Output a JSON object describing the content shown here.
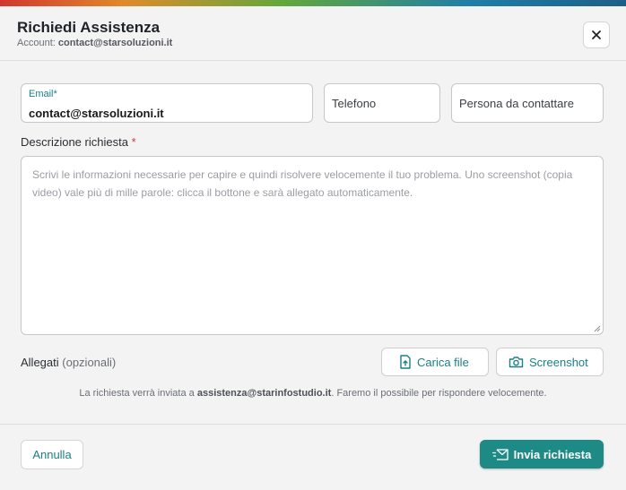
{
  "dialog": {
    "title": "Richiedi Assistenza",
    "account_label": "Account:",
    "account_value": "contact@starsoluzioni.it"
  },
  "form": {
    "email_label": "Email*",
    "email_value": "contact@starsoluzioni.it",
    "phone_placeholder": "Telefono",
    "contact_placeholder": "Persona da contattare",
    "description_label": "Descrizione richiesta",
    "description_required_mark": "*",
    "description_placeholder": "Scrivi le informazioni necessarie per capire e quindi risolvere velocemente il tuo problema. Uno screenshot (copia video) vale più di mille parole: clicca il bottone e sarà allegato automaticamente.",
    "attachments_label": "Allegati",
    "attachments_optional": "(opzionali)",
    "upload_button": "Carica file",
    "screenshot_button": "Screenshot"
  },
  "info": {
    "prefix": "La richiesta verrà inviata a",
    "email": "assistenza@starinfostudio.it",
    "suffix": ". Faremo il possibile per rispondere velocemente."
  },
  "footer": {
    "cancel_button": "Annulla",
    "send_button": "Invia richiesta"
  },
  "colors": {
    "accent": "#1b7f86",
    "primary_button": "#1d8a86",
    "required": "#d33a36"
  },
  "icons": [
    "close-icon",
    "file-upload-icon",
    "camera-icon",
    "send-mail-icon",
    "resize-handle-icon"
  ]
}
